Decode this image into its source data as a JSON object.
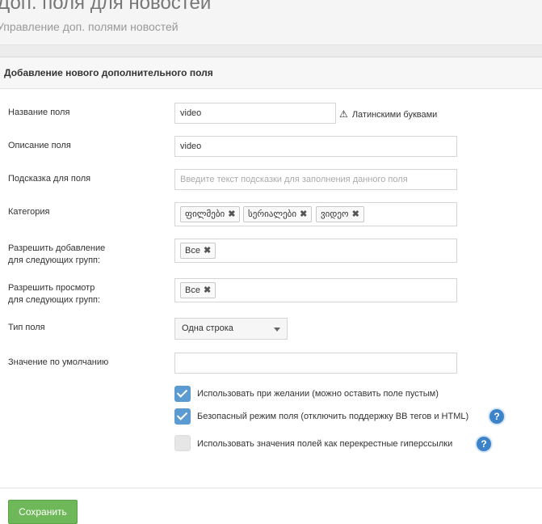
{
  "header": {
    "title": "Доп. поля для новостей",
    "subtitle": "Управление доп. полями новостей"
  },
  "panel": {
    "heading": "Добавление нового дополнительного поля"
  },
  "form": {
    "field_name": {
      "label": "Название поля",
      "value": "video",
      "hint": "Латинскими буквами"
    },
    "field_description": {
      "label": "Описание поля",
      "value": "video"
    },
    "field_tooltip": {
      "label": "Подсказка для поля",
      "placeholder": "Введите текст подсказки для заполнения данного поля"
    },
    "category": {
      "label": "Категория",
      "tags": [
        "ფილმები",
        "სერიალები",
        "ვიდეო"
      ]
    },
    "allow_add": {
      "label_line1": "Разрешить добавление",
      "label_line2": "для следующих групп:",
      "tags": [
        "Все"
      ]
    },
    "allow_view": {
      "label_line1": "Разрешить просмотр",
      "label_line2": "для следующих групп:",
      "tags": [
        "Все"
      ]
    },
    "field_type": {
      "label": "Тип поля",
      "selected": "Одна строка"
    },
    "default_value": {
      "label": "Значение по умолчанию",
      "value": ""
    },
    "checkboxes": [
      {
        "label": "Использовать при желании (можно оставить поле пустым)",
        "checked": true
      },
      {
        "label": "Безопасный режим поля (отключить поддержку BB тегов и HTML)",
        "checked": true
      },
      {
        "label": "Использовать значения полей как перекрестные гиперссылки",
        "checked": false
      }
    ],
    "tag_remove_glyph": "✖",
    "help_glyph": "?",
    "warning_glyph": "⚠"
  },
  "footer": {
    "save_label": "Сохранить"
  },
  "colors": {
    "accent_checkbox": "#5b9bd1",
    "help_icon": "#3d83c9",
    "save_button": "#6fb85a"
  }
}
